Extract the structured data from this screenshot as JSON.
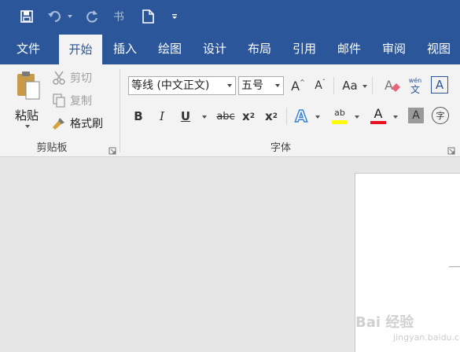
{
  "qat": {
    "save_icon": "save-icon",
    "undo_icon": "undo-icon",
    "redo_icon": "redo-icon",
    "format_icon": "format-painter-icon",
    "new_icon": "new-document-icon"
  },
  "tabs": [
    {
      "label": "文件"
    },
    {
      "label": "开始"
    },
    {
      "label": "插入"
    },
    {
      "label": "绘图"
    },
    {
      "label": "设计"
    },
    {
      "label": "布局"
    },
    {
      "label": "引用"
    },
    {
      "label": "邮件"
    },
    {
      "label": "审阅"
    },
    {
      "label": "视图"
    }
  ],
  "clipboard": {
    "paste_label": "粘贴",
    "cut_label": "剪切",
    "copy_label": "复制",
    "format_painter_label": "格式刷",
    "group_label": "剪贴板"
  },
  "font": {
    "font_name": "等线 (中文正文)",
    "font_size": "五号",
    "grow_label": "A",
    "shrink_label": "A",
    "case_label": "Aa",
    "bold_label": "B",
    "italic_label": "I",
    "underline_label": "U",
    "strike_label": "abc",
    "subscript_label": "x",
    "subscript_sub": "2",
    "superscript_label": "x",
    "superscript_sup": "2",
    "phonetic_top": "wén",
    "phonetic_bottom": "文",
    "border_label": "A",
    "effects_label": "A",
    "highlight_label": "ab",
    "color_label": "A",
    "shading_label": "A",
    "enclose_label": "字",
    "group_label": "字体"
  },
  "colors": {
    "brand": "#2b579a",
    "highlight": "#ffff00",
    "font_color": "#e81123"
  },
  "watermark": {
    "text": "Bai 经验",
    "sub": "jingyan.baidu.com"
  }
}
